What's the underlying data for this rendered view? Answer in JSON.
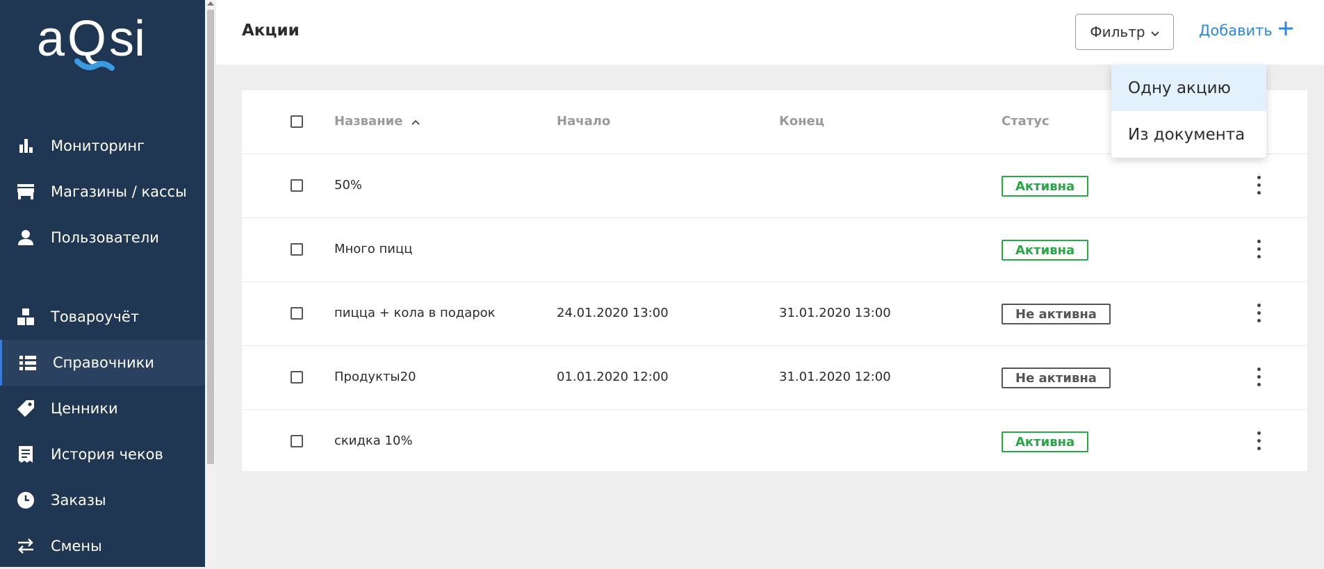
{
  "sidebar": {
    "logo_text": "aQsi",
    "items": [
      {
        "label": "Мониторинг",
        "icon": "bar-chart-icon"
      },
      {
        "label": "Магазины / кассы",
        "icon": "store-icon"
      },
      {
        "label": "Пользователи",
        "icon": "user-icon"
      },
      {
        "label": "Товароучёт",
        "icon": "boxes-icon"
      },
      {
        "label": "Справочники",
        "icon": "list-icon",
        "active": true
      },
      {
        "label": "Ценники",
        "icon": "tag-icon"
      },
      {
        "label": "История чеков",
        "icon": "receipt-icon"
      },
      {
        "label": "Заказы",
        "icon": "clock-icon"
      },
      {
        "label": "Смены",
        "icon": "swap-icon"
      }
    ]
  },
  "header": {
    "title": "Акции",
    "filter_label": "Фильтр",
    "add_label": "Добавить"
  },
  "table": {
    "columns": {
      "name": "Название",
      "start": "Начало",
      "end": "Конец",
      "status": "Статус"
    },
    "sort": {
      "column": "name",
      "direction": "asc"
    },
    "rows": [
      {
        "name": "50%",
        "start": "",
        "end": "",
        "status": "Активна"
      },
      {
        "name": "Много пицц",
        "start": "",
        "end": "",
        "status": "Активна"
      },
      {
        "name": "пицца + кола в подарок",
        "start": "24.01.2020 13:00",
        "end": "31.01.2020 13:00",
        "status": "Не активна"
      },
      {
        "name": "Продукты20",
        "start": "01.01.2020 12:00",
        "end": "31.01.2020 12:00",
        "status": "Не активна"
      },
      {
        "name": "скидка 10%",
        "start": "",
        "end": "",
        "status": "Активна"
      }
    ]
  },
  "add_menu": {
    "items": [
      "Одну акцию",
      "Из документа"
    ]
  },
  "colors": {
    "sidebar_bg": "#1f3752",
    "accent": "#2d86e0",
    "active_status": "#28a745",
    "inactive_status": "#555555",
    "logo_accent": "#3a9be0"
  }
}
